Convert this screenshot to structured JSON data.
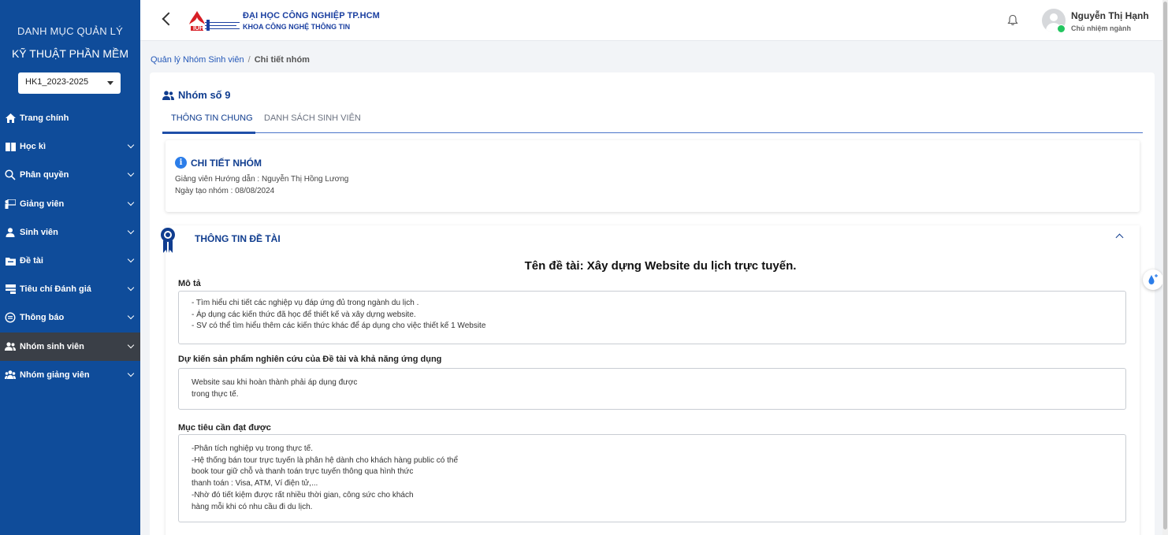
{
  "sidebar": {
    "title_line1": "DANH MỤC QUẢN LÝ",
    "title_line2": "KỸ THUẬT PHẦN MỀM",
    "semester": "HK1_2023-2025",
    "items": [
      {
        "label": "Trang chính",
        "icon": "home-icon",
        "has_submenu": false
      },
      {
        "label": "Học kì",
        "icon": "book-icon",
        "has_submenu": true
      },
      {
        "label": "Phân quyền",
        "icon": "key-search-icon",
        "has_submenu": true
      },
      {
        "label": "Giảng viên",
        "icon": "teacher-icon",
        "has_submenu": true
      },
      {
        "label": "Sinh viên",
        "icon": "user-icon",
        "has_submenu": true
      },
      {
        "label": "Đề tài",
        "icon": "folder-icon",
        "has_submenu": true
      },
      {
        "label": "Tiêu chí Đánh giá",
        "icon": "criteria-icon",
        "has_submenu": true
      },
      {
        "label": "Thông báo",
        "icon": "message-icon",
        "has_submenu": true
      },
      {
        "label": "Nhóm sinh viên",
        "icon": "group-icon",
        "has_submenu": true,
        "active": true
      },
      {
        "label": "Nhóm giảng viên",
        "icon": "lecturer-group-icon",
        "has_submenu": true
      }
    ]
  },
  "header": {
    "university_name": "ĐẠI HỌC CÔNG NGHIỆP TP.HCM",
    "faculty_name": "KHOA CÔNG NGHỆ THÔNG TIN",
    "user_name": "Nguyễn Thị Hạnh",
    "user_role": "Chủ nhiệm ngành"
  },
  "breadcrumb": {
    "parent": "Quản lý Nhóm Sinh viên",
    "separator": "/",
    "current": "Chi tiết nhóm"
  },
  "group": {
    "title": "Nhóm số 9",
    "tabs": [
      "THÔNG TIN CHUNG",
      "DANH SÁCH SINH VIÊN"
    ],
    "active_tab": 0
  },
  "detail": {
    "heading": "CHI TIẾT NHÓM",
    "advisor": "Giảng viên Hướng dẫn : Nguyễn Thị Hồng Lương",
    "created": "Ngày tạo nhóm : 08/08/2024"
  },
  "topic": {
    "heading": "THÔNG TIN ĐỀ TÀI",
    "name": "Tên đề tài: Xây dựng Website du lịch trực tuyến.",
    "description_label": "Mô tả",
    "description": "- Tìm hiểu chi tiết các nghiệp vụ đáp ứng đủ trong ngành du lịch .\n- Áp dụng các kiến thức đã học để thiết kế và xây dựng website.\n- SV có thể tìm hiểu thêm các kiến thức khác để áp dụng cho việc thiết kế 1 Website",
    "expected_label": "Dự kiến sản phẩm nghiên cứu của Đề tài và khả năng ứng dụng",
    "expected": "Website sau khi hoàn thành phải áp dụng được\ntrong thực tế.",
    "goals_label": "Mục tiêu cần đạt được",
    "goals": "-Phân tích nghiệp vụ trong thực tế.\n-Hệ thống bán tour trực tuyến là phân hệ dành cho khách hàng public có thể\nbook tour giữ chỗ và thanh toán trực tuyến thông qua hình thức\n thanh toán : Visa, ATM, Ví điện tử,...\n-Nhờ đó tiết kiệm được rất nhiều thời gian, công sức cho khách\nhàng mỗi khi có nhu cầu đi du lịch."
  },
  "colors": {
    "sidebar_bg": "#0f4c9a",
    "active_item_bg": "#3a3f47",
    "accent": "#103d8f",
    "online": "#22c55e"
  }
}
